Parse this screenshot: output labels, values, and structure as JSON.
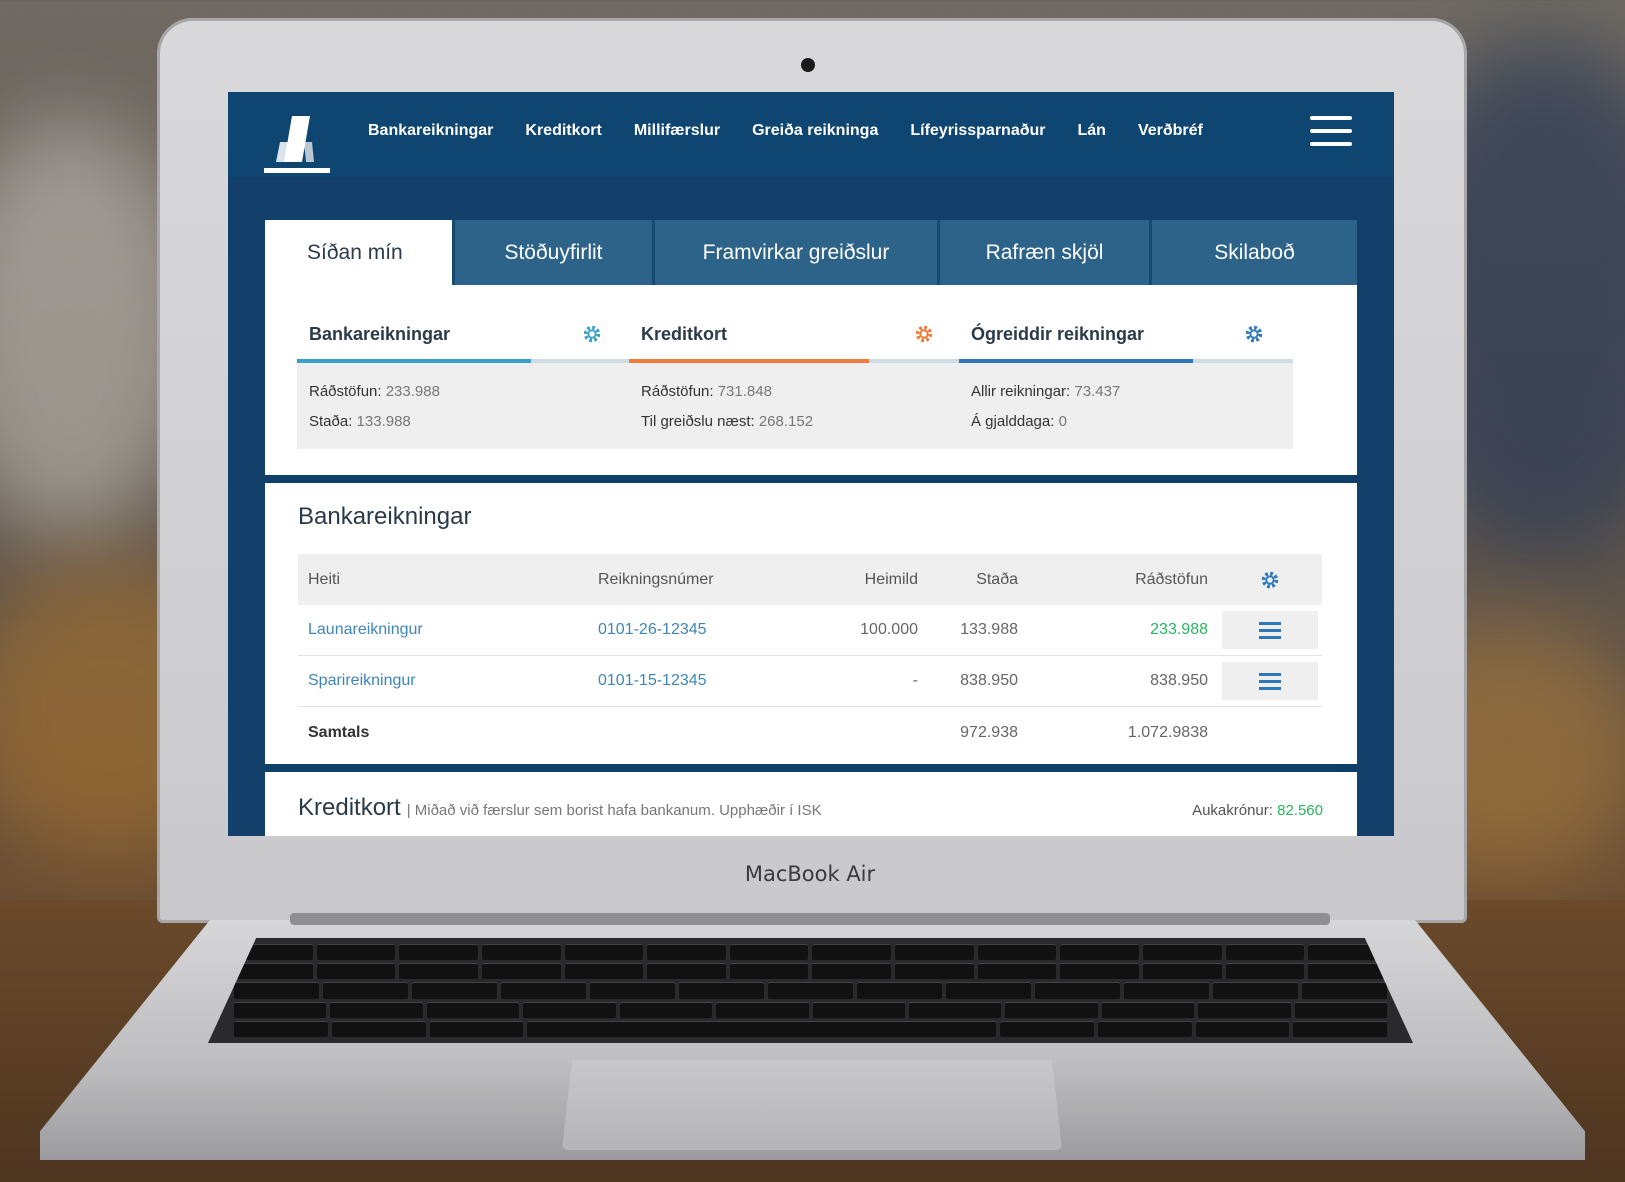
{
  "device": {
    "brand_label": "MacBook Air"
  },
  "nav": {
    "items": [
      "Bankareikningar",
      "Kreditkort",
      "Millifærslur",
      "Greiða reikninga",
      "Lífeyrissparnaður",
      "Lán",
      "Verðbréf"
    ]
  },
  "tabs": [
    {
      "label": "Síðan mín",
      "active": true
    },
    {
      "label": "Stöðuyfirlit",
      "active": false
    },
    {
      "label": "Framvirkar greiðslur",
      "active": false
    },
    {
      "label": "Rafræn skjöl",
      "active": false
    },
    {
      "label": "Skilaboð",
      "active": false
    }
  ],
  "summary": [
    {
      "title": "Bankareikningar",
      "accent_color": "#3aa0c8",
      "gear_color": "#3aa0c8",
      "lines": [
        {
          "label": "Ráðstöfun:",
          "value": "233.988"
        },
        {
          "label": "Staða:",
          "value": "133.988"
        }
      ]
    },
    {
      "title": "Kreditkort",
      "accent_color": "#f07a3a",
      "gear_color": "#f07a3a",
      "lines": [
        {
          "label": "Ráðstöfun:",
          "value": "731.848"
        },
        {
          "label": "Til greiðslu næst:",
          "value": "268.152"
        }
      ]
    },
    {
      "title": "Ógreiddir reikningar",
      "accent_color": "#2f78b8",
      "gear_color": "#2f78b8",
      "lines": [
        {
          "label": "Allir reikningar:",
          "value": "73.437"
        },
        {
          "label": "Á gjalddaga:",
          "value": "0"
        }
      ]
    }
  ],
  "accounts": {
    "title": "Bankareikningar",
    "columns": [
      "Heiti",
      "Reikningsnúmer",
      "Heimild",
      "Staða",
      "Ráðstöfun"
    ],
    "rows": [
      {
        "name": "Launareikningur",
        "number": "0101-26-12345",
        "limit": "100.000",
        "balance": "133.988",
        "available": "233.988"
      },
      {
        "name": "Sparireikningur",
        "number": "0101-15-12345",
        "limit": "-",
        "balance": "838.950",
        "available": "838.950"
      }
    ],
    "total": {
      "label": "Samtals",
      "balance": "972.938",
      "available": "1.072.9838"
    }
  },
  "credit": {
    "title": "Kreditkort",
    "subtitle": "| Miðað við færslur sem borist hafa bankanum. Upphæðir í ISK",
    "extra_label": "Aukakrónur:",
    "extra_value": "82.560"
  },
  "colors": {
    "brand_navy": "#0f4571",
    "tab_blue": "#2d6389",
    "link": "#3f86b8",
    "positive": "#2ab45e"
  }
}
